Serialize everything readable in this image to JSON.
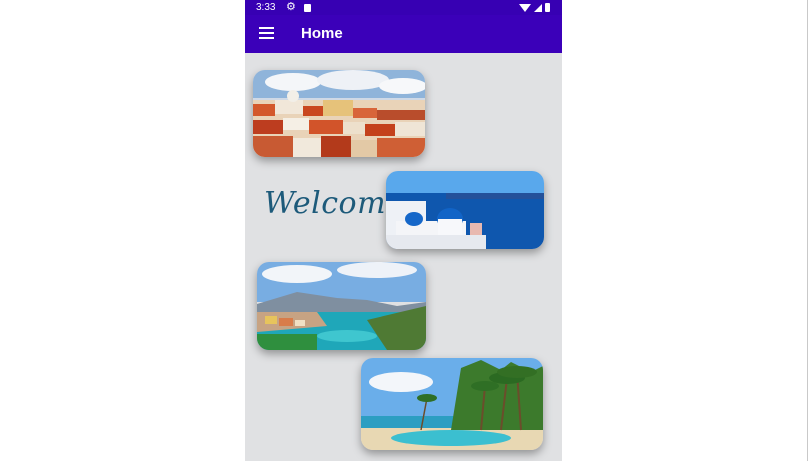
{
  "status_bar": {
    "time": "3:33",
    "icons": [
      "gear-icon",
      "sd-card-icon",
      "wifi-icon",
      "cell-signal-icon",
      "battery-icon"
    ]
  },
  "app_bar": {
    "title": "Home",
    "menu_icon": "hamburger-menu-icon",
    "color": "#3b00b9"
  },
  "content": {
    "welcome_text": "Welcome",
    "images": [
      {
        "id": "lisbon-houses-image"
      },
      {
        "id": "santorini-domes-image"
      },
      {
        "id": "greek-island-bay-image"
      },
      {
        "id": "tropical-beach-image"
      }
    ]
  }
}
